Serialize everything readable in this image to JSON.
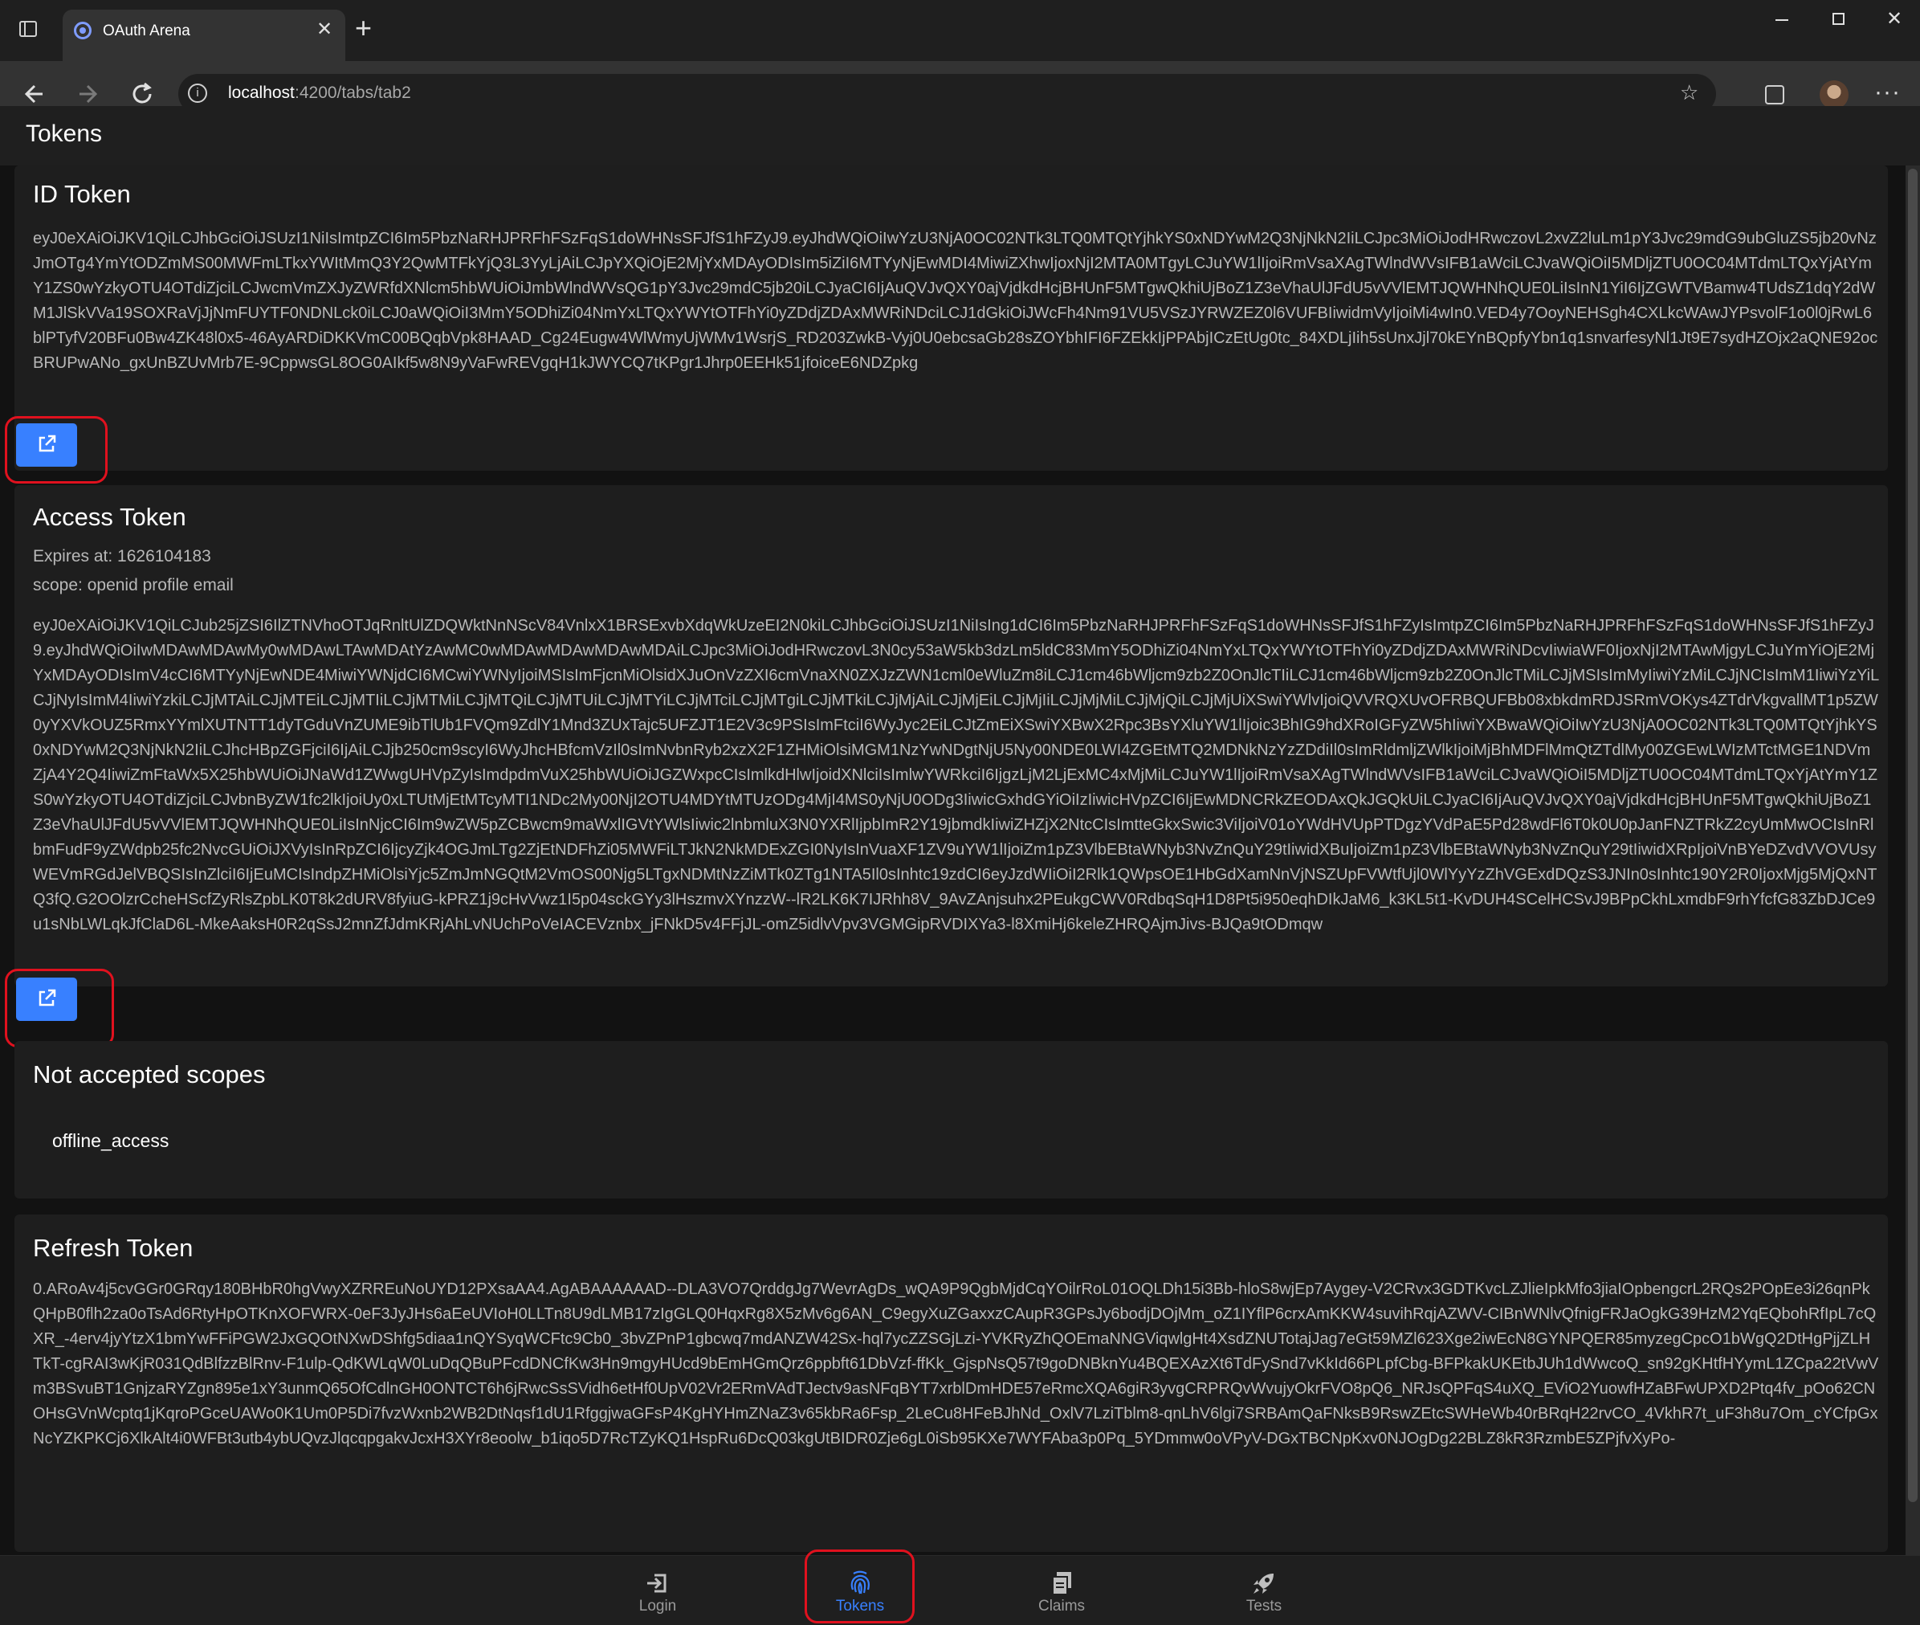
{
  "browser": {
    "tab_title": "OAuth Arena",
    "url_host": "localhost",
    "url_path": ":4200/tabs/tab2"
  },
  "page": {
    "title": "Tokens"
  },
  "id_token": {
    "heading": "ID Token",
    "value": "eyJ0eXAiOiJKV1QiLCJhbGciOiJSUzI1NiIsImtpZCI6Im5PbzNaRHJPRFhFSzFqS1doWHNsSFJfS1hFZyJ9.eyJhdWQiOiIwYzU3NjA0OC02NTk3LTQ0MTQtYjhkYS0xNDYwM2Q3NjNkN2IiLCJpc3MiOiJodHRwczovL2xvZ2luLm1pY3Jvc29mdG9ubGluZS5jb20vNzJmOTg4YmYtODZmMS00MWFmLTkxYWItMmQ3Y2QwMTFkYjQ3L3YyLjAiLCJpYXQiOjE2MjYxMDAyODIsIm5iZiI6MTYyNjEwMDI4MiwiZXhwIjoxNjI2MTA0MTgyLCJuYW1lIjoiRmVsaXAgTWlndWVsIFB1aWciLCJvaWQiOiI5MDljZTU0OC04MTdmLTQxYjAtYmY1ZS0wYzkyOTU4OTdiZjciLCJwcmVmZXJyZWRfdXNlcm5hbWUiOiJmbWlndWVsQG1pY3Jvc29mdC5jb20iLCJyaCI6IjAuQVJvQXY0ajVjdkdHcjBHUnF5MTgwQkhiUjBoZ1Z3eVhaUlJFdU5vVVlEMTJQWHNhQUE0LiIsInN1YiI6IjZGWTVBamw4TUdsZ1dqY2dWM1JlSkVVa19SOXRaVjJjNmFUYTF0NDNLck0iLCJ0aWQiOiI3MmY5ODhiZi04NmYxLTQxYWYtOTFhYi0yZDdjZDAxMWRiNDciLCJ1dGkiOiJWcFh4Nm91VU5VSzJYRWZEZ0l6VUFBIiwidmVyIjoiMi4wIn0.VED4y7OoyNEHSgh4CXLkcWAwJYPsvolF1o0l0jRwL6blPTyfV20BFu0Bw4ZK48l0x5-46AyARDiDKKVmC00BQqbVpk8HAAD_Cg24Eugw4WlWmyUjWMv1WsrjS_RD203ZwkB-Vyj0U0ebcsaGb28sZOYbhIFI6FZEkkIjPPAbjICzEtUg0tc_84XDLjIih5sUnxJjl70kEYnBQpfyYbn1q1snvarfesyNl1Jt9E7sydHZOjx2aQNE92ocBRUPwANo_gxUnBZUvMrb7E-9CppwsGL8OG0AIkf5w8N9yVaFwREVgqH1kJWYCQ7tKPgr1Jhrp0EEHk51jfoiceE6NDZpkg"
  },
  "access_token": {
    "heading": "Access Token",
    "expires": "Expires at: 1626104183",
    "scope": "scope: openid profile email",
    "value": "eyJ0eXAiOiJKV1QiLCJub25jZSI6IlZTNVhoOTJqRnltUlZDQWktNnNScV84VnlxX1BRSExvbXdqWkUzeEI2N0kiLCJhbGciOiJSUzI1NiIsIng1dCI6Im5PbzNaRHJPRFhFSzFqS1doWHNsSFJfS1hFZyIsImtpZCI6Im5PbzNaRHJPRFhFSzFqS1doWHNsSFJfS1hFZyJ9.eyJhdWQiOiIwMDAwMDAwMy0wMDAwLTAwMDAtYzAwMC0wMDAwMDAwMDAwMDAiLCJpc3MiOiJodHRwczovL3N0cy53aW5kb3dzLm5ldC83MmY5ODhiZi04NmYxLTQxYWYtOTFhYi0yZDdjZDAxMWRiNDcvIiwiaWF0IjoxNjI2MTAwMjgyLCJuYmYiOjE2MjYxMDAyODIsImV4cCI6MTYyNjEwNDE4MiwiYWNjdCI6MCwiYWNyIjoiMSIsImFjcnMiOlsidXJuOnVzZXI6cmVnaXN0ZXJzZWN1cml0eWluZm8iLCJ1cm46bWljcm9zb2Z0OnJlcTIiLCJ1cm46bWljcm9zb2Z0OnJlcTMiLCJjMSIsImMyIiwiYzMiLCJjNCIsImM1IiwiYzYiLCJjNyIsImM4IiwiYzkiLCJjMTAiLCJjMTEiLCJjMTIiLCJjMTMiLCJjMTQiLCJjMTUiLCJjMTYiLCJjMTciLCJjMTgiLCJjMTkiLCJjMjAiLCJjMjEiLCJjMjIiLCJjMjMiLCJjMjQiLCJjMjUiXSwiYWlvIjoiQVVRQXUvOFRBQUFBb08xbkdmRDJSRmVOKys4ZTdrVkgvallMT1p5ZW0yYXVkOUZ5RmxYYmlXUTNTT1dyTGduVnZUME9ibTlUb1FVQm9ZdlY1Mnd3ZUxTajc5UFZJT1E2V3c9PSIsImFtciI6WyJyc2EiLCJtZmEiXSwiYXBwX2Rpc3BsYXluYW1lIjoic3BhIG9hdXRoIGFyZW5hIiwiYXBwaWQiOiIwYzU3NjA0OC02NTk3LTQ0MTQtYjhkYS0xNDYwM2Q3NjNkN2IiLCJhcHBpZGFjciI6IjAiLCJjb250cm9scyI6WyJhcHBfcmVzIl0sImNvbnRyb2xzX2F1ZHMiOlsiMGM1NzYwNDgtNjU5Ny00NDE0LWI4ZGEtMTQ2MDNkNzYzZDdiIl0sImRldmljZWlkIjoiMjBhMDFlMmQtZTdlMy00ZGEwLWIzMTctMGE1NDVmZjA4Y2Q4IiwiZmFtaWx5X25hbWUiOiJNaWd1ZWwgUHVpZyIsImdpdmVuX25hbWUiOiJGZWxpcCIsImlkdHlwIjoidXNlciIsImlwYWRkciI6IjgzLjM2LjExMC4xMjMiLCJuYW1lIjoiRmVsaXAgTWlndWVsIFB1aWciLCJvaWQiOiI5MDljZTU0OC04MTdmLTQxYjAtYmY1ZS0wYzkyOTU4OTdiZjciLCJvbnByZW1fc2lkIjoiUy0xLTUtMjEtMTcyMTI1NDc2My00NjI2OTU4MDYtMTUzODg4MjI4MS0yNjU0ODg3IiwicGxhdGYiOiIzIiwicHVpZCI6IjEwMDNCRkZEODAxQkJGQkUiLCJyaCI6IjAuQVJvQXY0ajVjdkdHcjBHUnF5MTgwQkhiUjBoZ1Z3eVhaUlJFdU5vVVlEMTJQWHNhQUE0LiIsInNjcCI6Im9wZW5pZCBwcm9maWxlIGVtYWlsIiwic2lnbmluX3N0YXRlIjpbImR2Y19jbmdkIiwiZHZjX2NtcCIsImtteGkxSwic3ViIjoiV01oYWdHVUpPTDgzYVdPaE5Pd28wdFl6T0k0U0pJanFNZTRkZ2cyUmMwOCIsInRlbmFudF9yZWdpb25fc2NvcGUiOiJXVyIsInRpZCI6IjcyZjk4OGJmLTg2ZjEtNDFhZi05MWFiLTJkN2NkMDExZGI0NyIsInVuaXF1ZV9uYW1lIjoiZm1pZ3VlbEBtaWNyb3NvZnQuY29tIiwidXBuIjoiZm1pZ3VlbEBtaWNyb3NvZnQuY29tIiwidXRpIjoiVnBYeDZvdVVOVUsyWEVmRGdJelVBQSIsInZlciI6IjEuMCIsIndpZHMiOlsiYjc5ZmJmNGQtM2VmOS00Njg5LTgxNDMtNzZiMTk0ZTg1NTA5Il0sInhtc19zdCI6eyJzdWIiOiI2Rlk1QWpsOE1HbGdXamNnVjNSZUpFVWtfUjl0WlYyYzZhVGExdDQzS3JNIn0sInhtc190Y2R0IjoxMjg5MjQxNTQ3fQ.G2OOlzrCcheHScfZyRlsZpbLK0T8k2dURV8fyiuG-kPRZ1j9cHvVwz1I5p04sckGYy3lHszmvXYnzzW--lR2LK6K7IJRhh8V_9AvZAnjsuhx2PEukgCWV0RdbqSqH1D8Pt5i950eqhDIkJaM6_k3KL5t1-KvDUH4SCelHCSvJ9BPpCkhLxmdbF9rhYfcfG83ZbDJCe9u1sNbLWLqkJfClaD6L-MkeAaksH0R2qSsJ2mnZfJdmKRjAhLvNUchPoVeIACEVznbx_jFNkD5v4FFjJL-omZ5idlvVpv3VGMGipRVDIXYa3-l8XmiHj6keleZHRQAjmJivs-BJQa9tODmqw"
  },
  "not_accepted": {
    "heading": "Not accepted scopes",
    "items": [
      "offline_access"
    ]
  },
  "refresh_token": {
    "heading": "Refresh Token",
    "value": "0.ARoAv4j5cvGGr0GRqy180BHbR0hgVwyXZRREuNoUYD12PXsaAA4.AgABAAAAAAD--DLA3VO7QrddgJg7WevrAgDs_wQA9P9QgbMjdCqYOilrRoL01OQLDh15i3Bb-hloS8wjEp7Aygey-V2CRvx3GDTKvcLZJlieIpkMfo3jiaIOpbengcrL2RQs2POpEe3i26qnPkQHpB0flh2za0oTsAd6RtyHpOTKnXOFWRX-0eF3JyJHs6aEeUVIoH0LLTn8U9dLMB17zIgGLQ0HqxRg8X5zMv6g6AN_C9egyXuZGaxxzCAupR3GPsJy6bodjDOjMm_oZ1IYflP6crxAmKKW4suvihRqjAZWV-CIBnWNlvQfnigFRJaOgkG39HzM2YqEQbohRfIpL7cQXR_-4erv4jyYtzX1bmYwFFiPGW2JxGQOtNXwDShfg5diaa1nQYSyqWCFtc9Cb0_3bvZPnP1gbcwq7mdANZW42Sx-hql7ycZZSGjLzi-YVKRyZhQOEmaNNGViqwlgHt4XsdZNUTotajJag7eGt59MZl623Xge2iwEcN8GYNPQER85myzegCpcO1bWgQ2DtHgPjjZLHTkT-cgRAI3wKjR031QdBlfzzBlRnv-F1ulp-QdKWLqW0LuDqQBuPFcdDNCfKw3Hn9mgyHUcd9bEmHGmQrz6ppbft61DbVzf-ffKk_GjspNsQ57t9goDNBknYu4BQEXAzXt6TdFySnd7vKkId66PLpfCbg-BFPkakUKEtbJUh1dWwcoQ_sn92gKHtfHYymL1ZCpa22tVwVm3BSvuBT1GnjzaRYZgn895e1xY3unmQ65OfCdlnGH0ONTCT6h6jRwcSsSVidh6etHf0UpV02Vr2ERmVAdTJectv9asNFqBYT7xrblDmHDE57eRmcXQA6giR3yvgCRPRQvWvujyOkrFVO8pQ6_NRJsQPFqS4uXQ_EViO2YuowfHZaBFwUPXD2Ptq4fv_pOo62CNOHsGVnWcptq1jKqroPGceUAWo0K1Um0P5Di7fvzWxnb2WB2DtNqsf1dU1RfggjwaGFsP4KgHYHmZNaZ3v65kbRa6Fsp_2LeCu8HFeBJhNd_OxlV7LziTblm8-qnLhV6lgi7SRBAmQaFNksB9RswZEtcSWHeWb40rBRqH22rvCO_4VkhR7t_uF3h8u7Om_cYCfpGxNcYZKPKCj6XlkAlt4i0WFBt3utb4ybUQvzJlqcqpgakvJcxH3XYr8eoolw_b1iqo5D7RcTZyKQ1HspRu6DcQ03kgUtBIDR0Zje6gL0iSb95KXe7WYFAba3p0Pq_5YDmmw0oVPyV-DGxTBCNpKxv0NJOgDg22BLZ8kR3RzmbE5ZPjfvXyPo-"
  },
  "tabbar": {
    "items": [
      {
        "label": "Login",
        "icon": "login-icon"
      },
      {
        "label": "Tokens",
        "icon": "fingerprint-icon",
        "active": true
      },
      {
        "label": "Claims",
        "icon": "documents-icon"
      },
      {
        "label": "Tests",
        "icon": "rocket-icon"
      }
    ]
  },
  "colors": {
    "accent": "#3880ff",
    "highlight": "#e0111e",
    "background": "#121212",
    "card": "#1e1e1e"
  }
}
